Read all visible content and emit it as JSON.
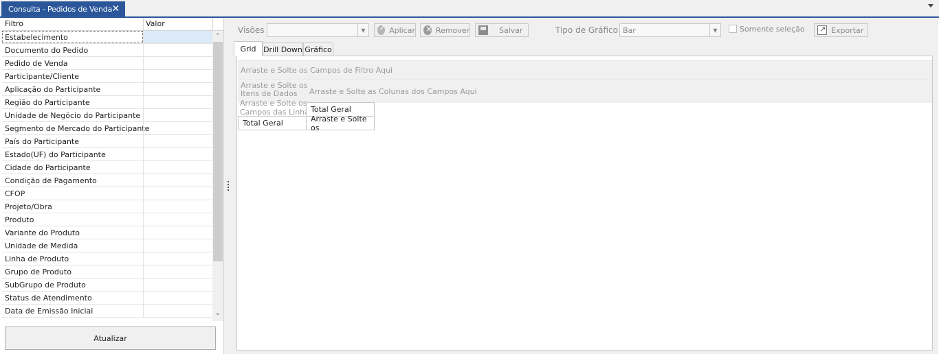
{
  "tab": {
    "title": "Consulta - Pedidos de Venda",
    "close": "✕"
  },
  "filter_grid": {
    "columns": [
      "Filtro",
      "Valor"
    ],
    "rows": [
      "Estabelecimento",
      "Documento do Pedido",
      "Pedido de Venda",
      "Participante/Cliente",
      "Aplicação do Participante",
      "Região do Participante",
      "Unidade de Negócio do Participante",
      "Segmento de Mercado do Participante",
      "País do Participante",
      "Estado(UF) do Participante",
      "Cidade do Participante",
      "Condição de Pagamento",
      "CFOP",
      "Projeto/Obra",
      "Produto",
      "Variante do Produto",
      "Unidade de Medida",
      "Linha de Produto",
      "Grupo de Produto",
      "SubGrupo de Produto",
      "Status de Atendimento",
      "Data de Emissão Inicial"
    ],
    "refresh_button": "Atualizar"
  },
  "toolbar": {
    "views_label": "Visões",
    "views_value": "",
    "apply_label": "Aplicar",
    "remove_label": "Remover",
    "save_label": "Salvar",
    "chart_type_label": "Tipo de Gráfico",
    "chart_type_value": "Bar",
    "selection_only_label": "Somente seleção",
    "export_label": "Exportar"
  },
  "inner_tabs": [
    "Grid",
    "Drill Down",
    "Gráfico"
  ],
  "pivot": {
    "filter_zone": "Arraste e Solte os Campos de Filtro Aqui",
    "data_zone_line1": "Arraste e Solte os",
    "data_zone_line2": "Itens de Dados",
    "column_zone": "Arraste e Solte as Colunas dos Campos Aqui",
    "row_zone_line1": "Arraste e Solte os",
    "row_zone_line2": "Campos das Linhas",
    "col_total": "Total Geral",
    "row_total": "Total Geral",
    "cell_placeholder": "Arraste e Solte os"
  }
}
